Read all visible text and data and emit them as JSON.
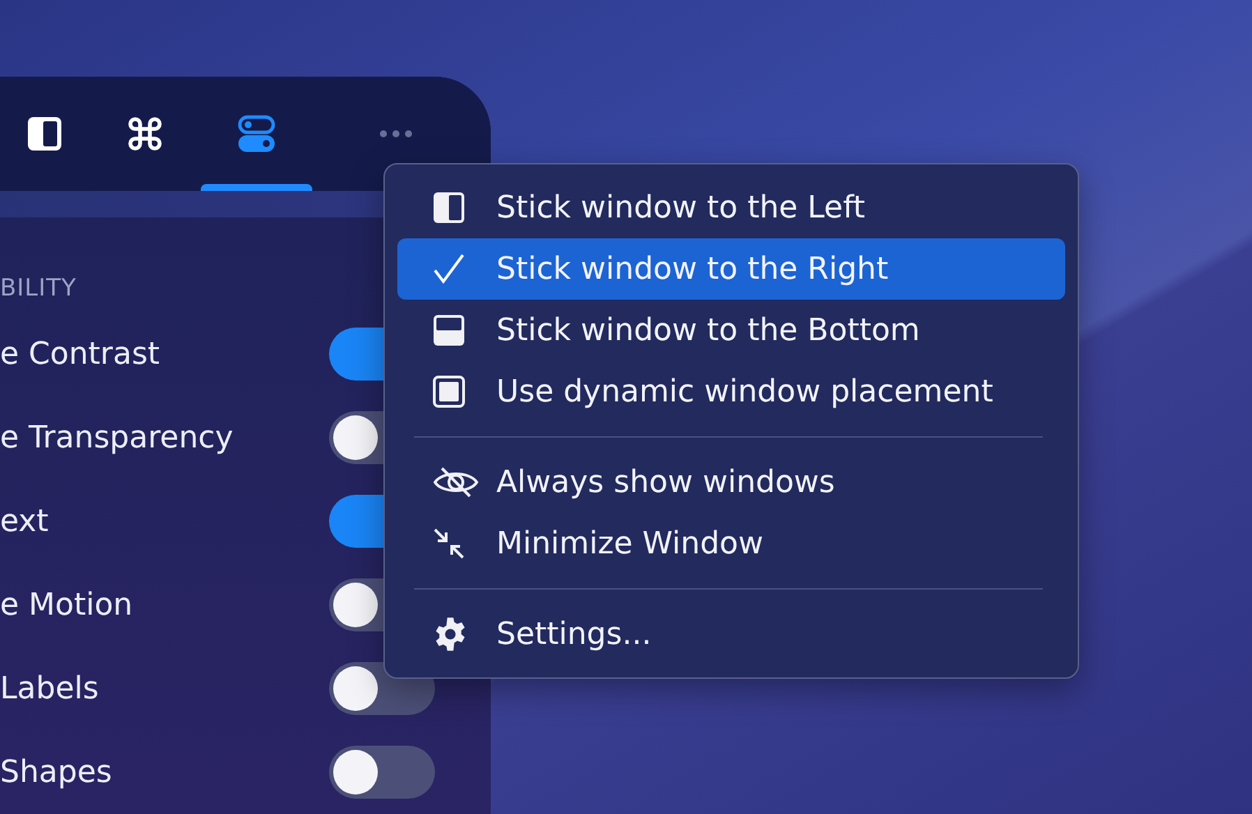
{
  "toolbar": {
    "tabs": [
      {
        "kind": "sidebar",
        "selected": false
      },
      {
        "kind": "command",
        "selected": false
      },
      {
        "kind": "toggles",
        "selected": true
      },
      {
        "kind": "more",
        "selected": false
      }
    ]
  },
  "settings": {
    "section_title": "BILITY",
    "rows": [
      {
        "label": "e Contrast",
        "on": true
      },
      {
        "label": "e Transparency",
        "on": false
      },
      {
        "label": "ext",
        "on": true
      },
      {
        "label": "e Motion",
        "on": false
      },
      {
        "label": "Labels",
        "on": false
      },
      {
        "label": "Shapes",
        "on": false
      }
    ]
  },
  "menu": {
    "groups": [
      [
        {
          "kind": "left",
          "label": "Stick window to the Left",
          "checked": false,
          "selected": false
        },
        {
          "kind": "right",
          "label": "Stick window to the Right",
          "checked": true,
          "selected": true
        },
        {
          "kind": "bottom",
          "label": "Stick window to the Bottom",
          "checked": false,
          "selected": false
        },
        {
          "kind": "dynamic",
          "label": "Use dynamic window placement",
          "checked": false,
          "selected": false
        }
      ],
      [
        {
          "kind": "eye",
          "label": "Always show windows",
          "checked": false,
          "selected": false
        },
        {
          "kind": "minimize",
          "label": "Minimize Window",
          "checked": false,
          "selected": false
        }
      ],
      [
        {
          "kind": "gear",
          "label": "Settings...",
          "checked": false,
          "selected": false
        }
      ]
    ]
  }
}
